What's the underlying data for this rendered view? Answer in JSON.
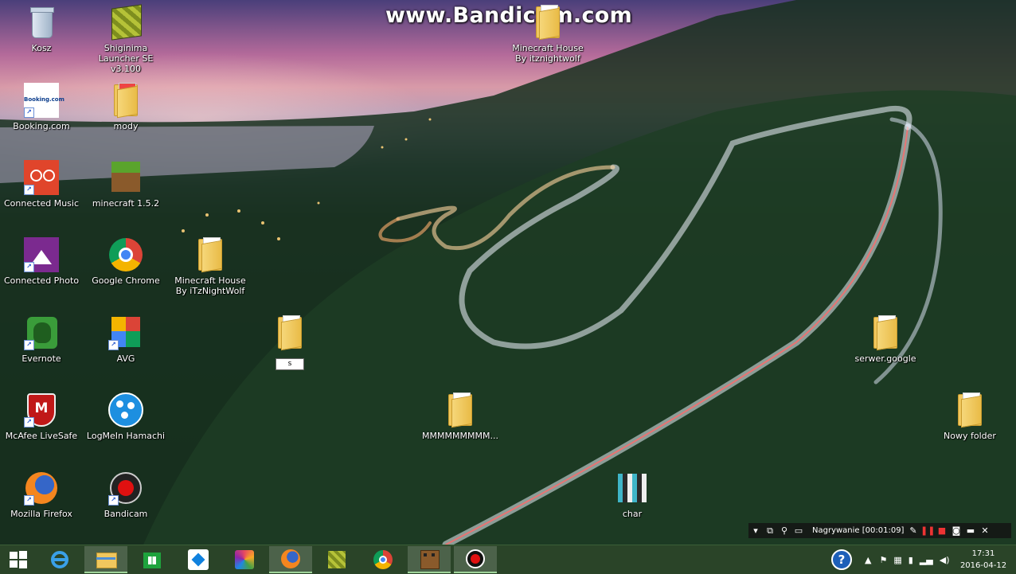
{
  "watermark": "www.Bandicam.com",
  "desktop_icons": [
    {
      "label": "Kosz"
    },
    {
      "label": "Shiginima Launcher SE v3.100"
    },
    {
      "label": "Booking.com",
      "icon_text": "Booking.com"
    },
    {
      "label": "mody"
    },
    {
      "label": "Connected Music"
    },
    {
      "label": "minecraft 1.5.2"
    },
    {
      "label": "Connected Photo"
    },
    {
      "label": "Google Chrome"
    },
    {
      "label": "Minecraft House By iTzNightWolf"
    },
    {
      "label": "Evernote"
    },
    {
      "label": "AVG"
    },
    {
      "label": "McAfee LiveSafe"
    },
    {
      "label": "LogMeIn Hamachi"
    },
    {
      "label": "Mozilla Firefox"
    },
    {
      "label": "Bandicam"
    },
    {
      "label": "Minecraft House By itznightwolf"
    },
    {
      "label": "s"
    },
    {
      "label": "MMMMMMMMM..."
    },
    {
      "label": "char"
    },
    {
      "label": "serwer.google"
    },
    {
      "label": "Nowy folder"
    }
  ],
  "recorder": {
    "status": "Nagrywanie [00:01:09]"
  },
  "taskbar": {
    "apps": [
      "start-icon",
      "internet-explorer-icon",
      "file-explorer-icon",
      "store-icon",
      "dropbox-icon",
      "photos-app-icon",
      "firefox-icon",
      "minecraft-launcher-icon",
      "chrome-icon",
      "minecraft-icon",
      "bandicam-icon"
    ],
    "clock_time": "17:31",
    "clock_date": "2016-04-12"
  },
  "colors": {
    "taskbar": "#183416",
    "folder": "#f0c75e"
  }
}
